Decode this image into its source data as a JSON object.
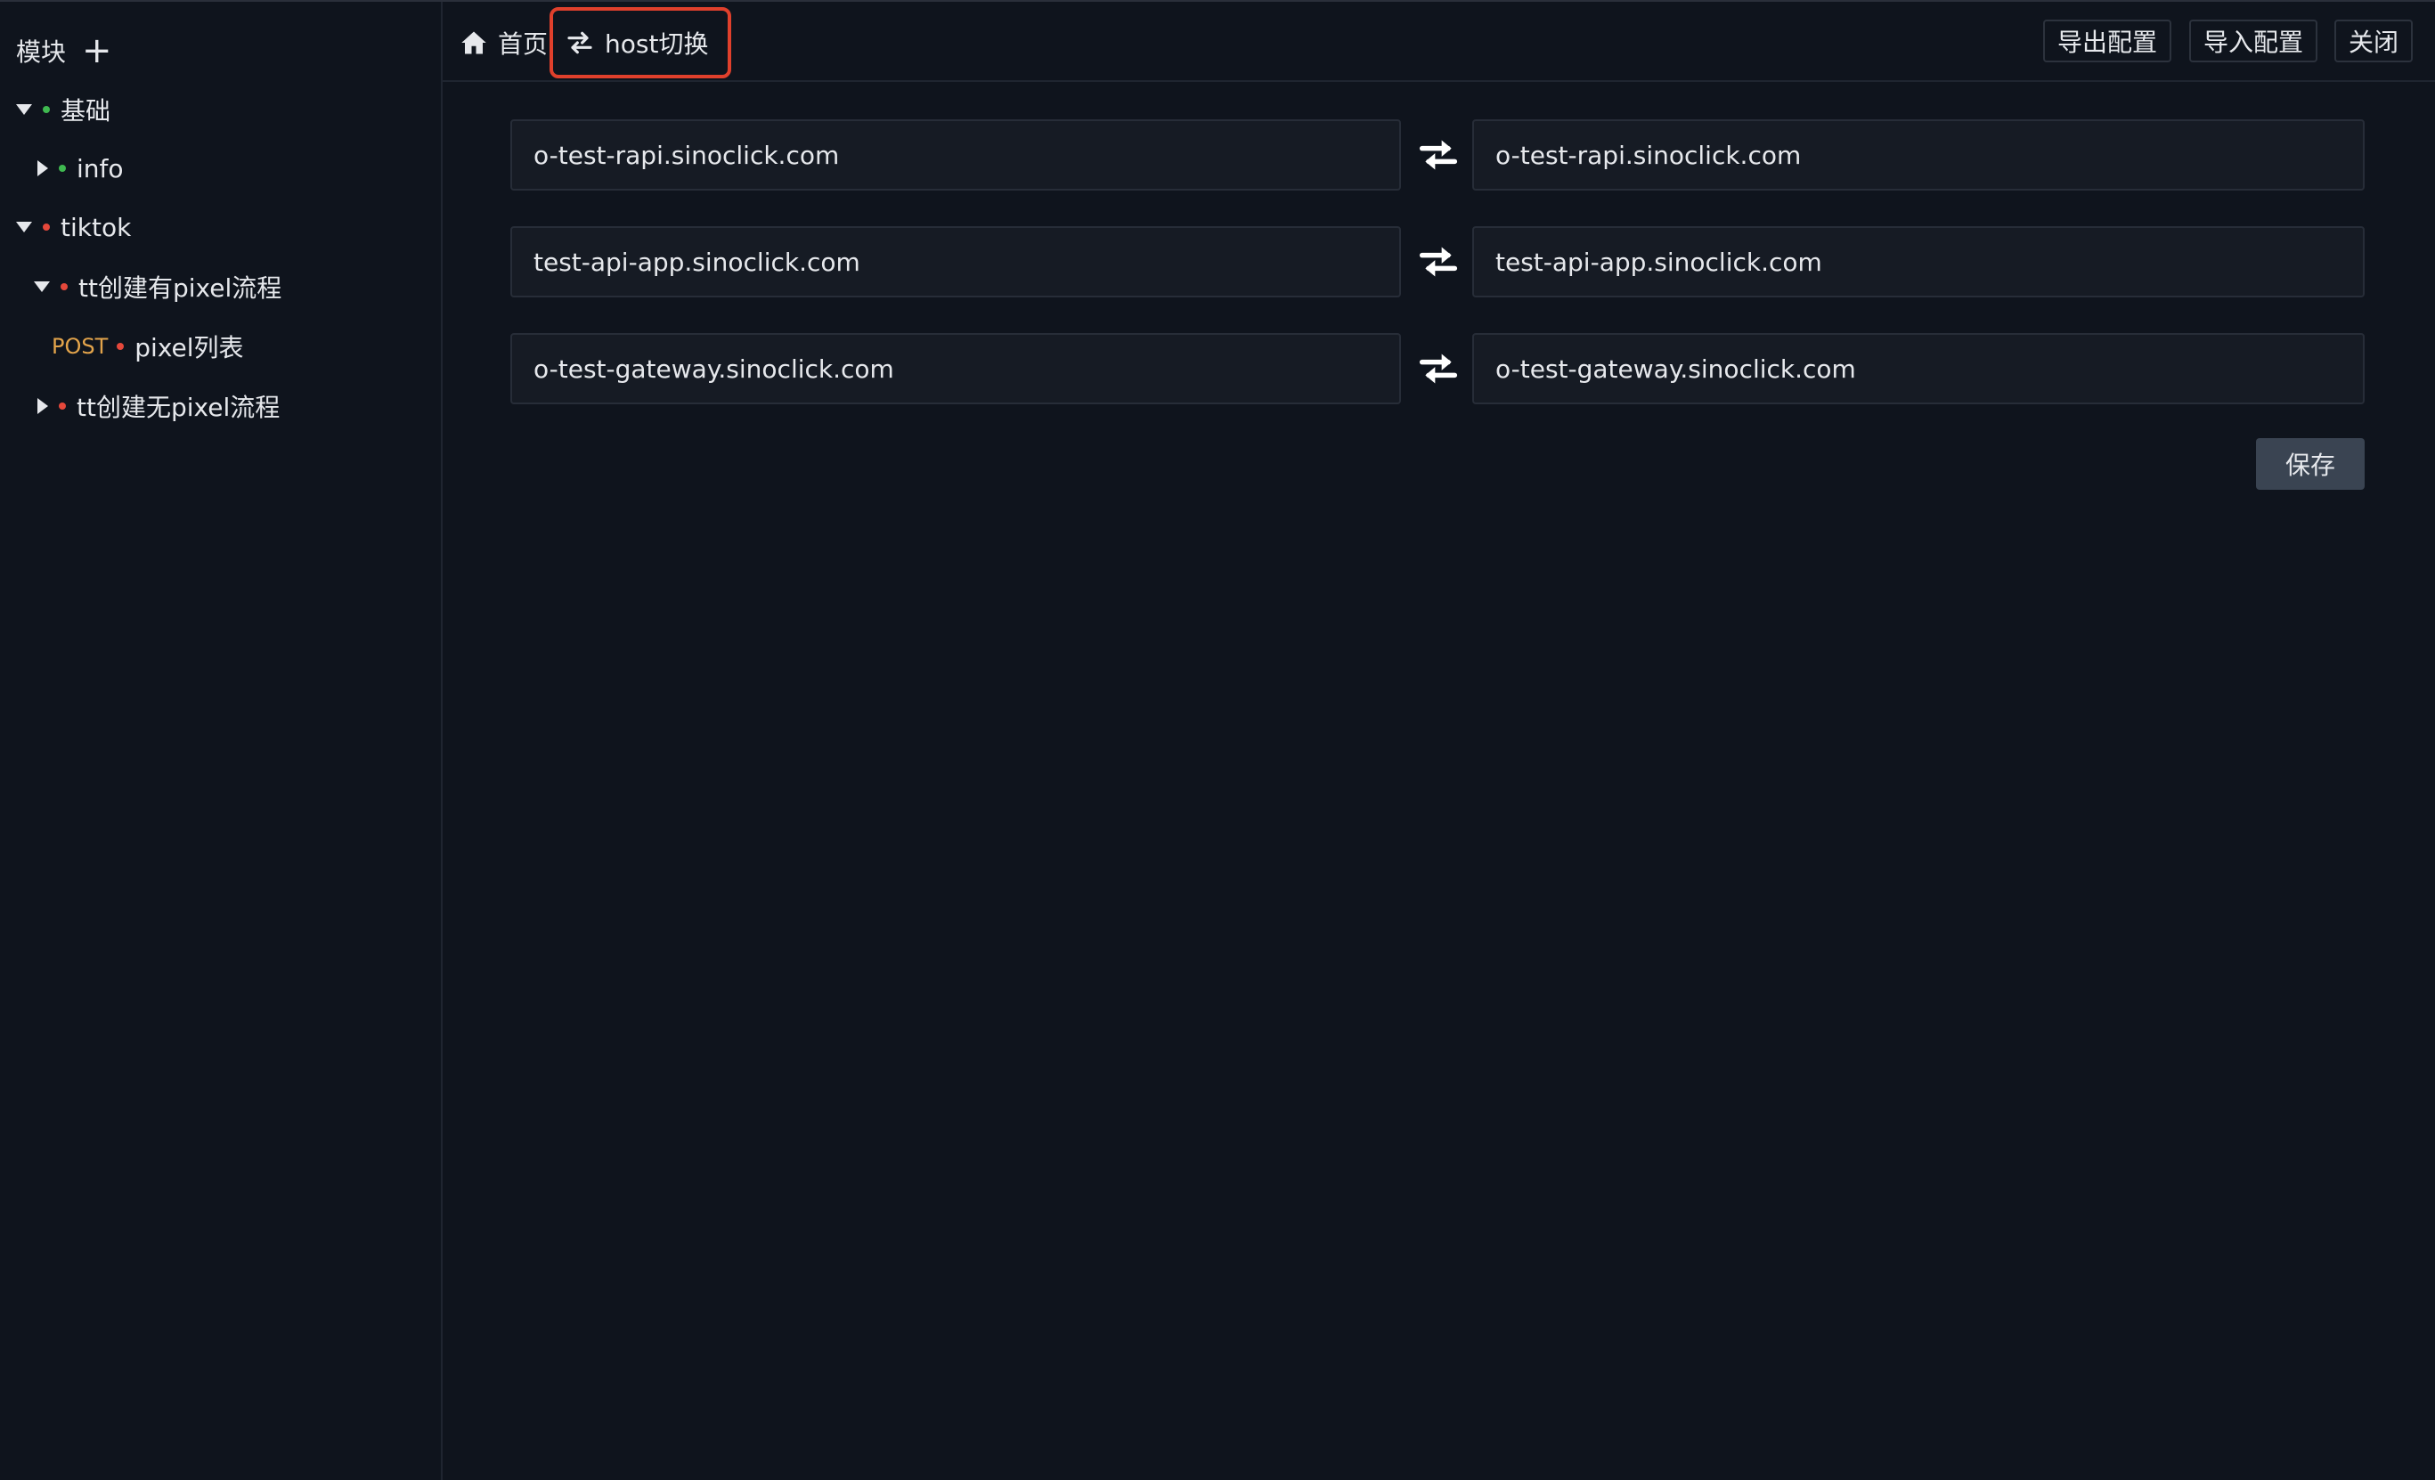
{
  "sidebar": {
    "title": "模块",
    "add_symbol": "+",
    "tree": [
      {
        "label": "基础",
        "dot_color": "#3fb950",
        "expanded": true
      },
      {
        "label": "info",
        "dot_color": "#3fb950",
        "expanded": false
      },
      {
        "label": "tiktok",
        "dot_color": "#e5483b",
        "expanded": true
      },
      {
        "label": "tt创建有pixel流程",
        "dot_color": "#e5483b",
        "expanded": true
      },
      {
        "label": "pixel列表",
        "method": "POST",
        "method_color": "#e3a44b",
        "dot_color": "#e5483b"
      },
      {
        "label": "tt创建无pixel流程",
        "dot_color": "#e5483b",
        "expanded": false
      }
    ]
  },
  "breadcrumb": {
    "home_label": "首页",
    "active_label": "host切换"
  },
  "toolbar": {
    "export_label": "导出配置",
    "import_label": "导入配置",
    "close_label": "关闭"
  },
  "hosts": [
    {
      "from": "o-test-rapi.sinoclick.com",
      "to": "o-test-rapi.sinoclick.com"
    },
    {
      "from": "test-api-app.sinoclick.com",
      "to": "test-api-app.sinoclick.com"
    },
    {
      "from": "o-test-gateway.sinoclick.com",
      "to": "o-test-gateway.sinoclick.com"
    }
  ],
  "save_label": "保存"
}
